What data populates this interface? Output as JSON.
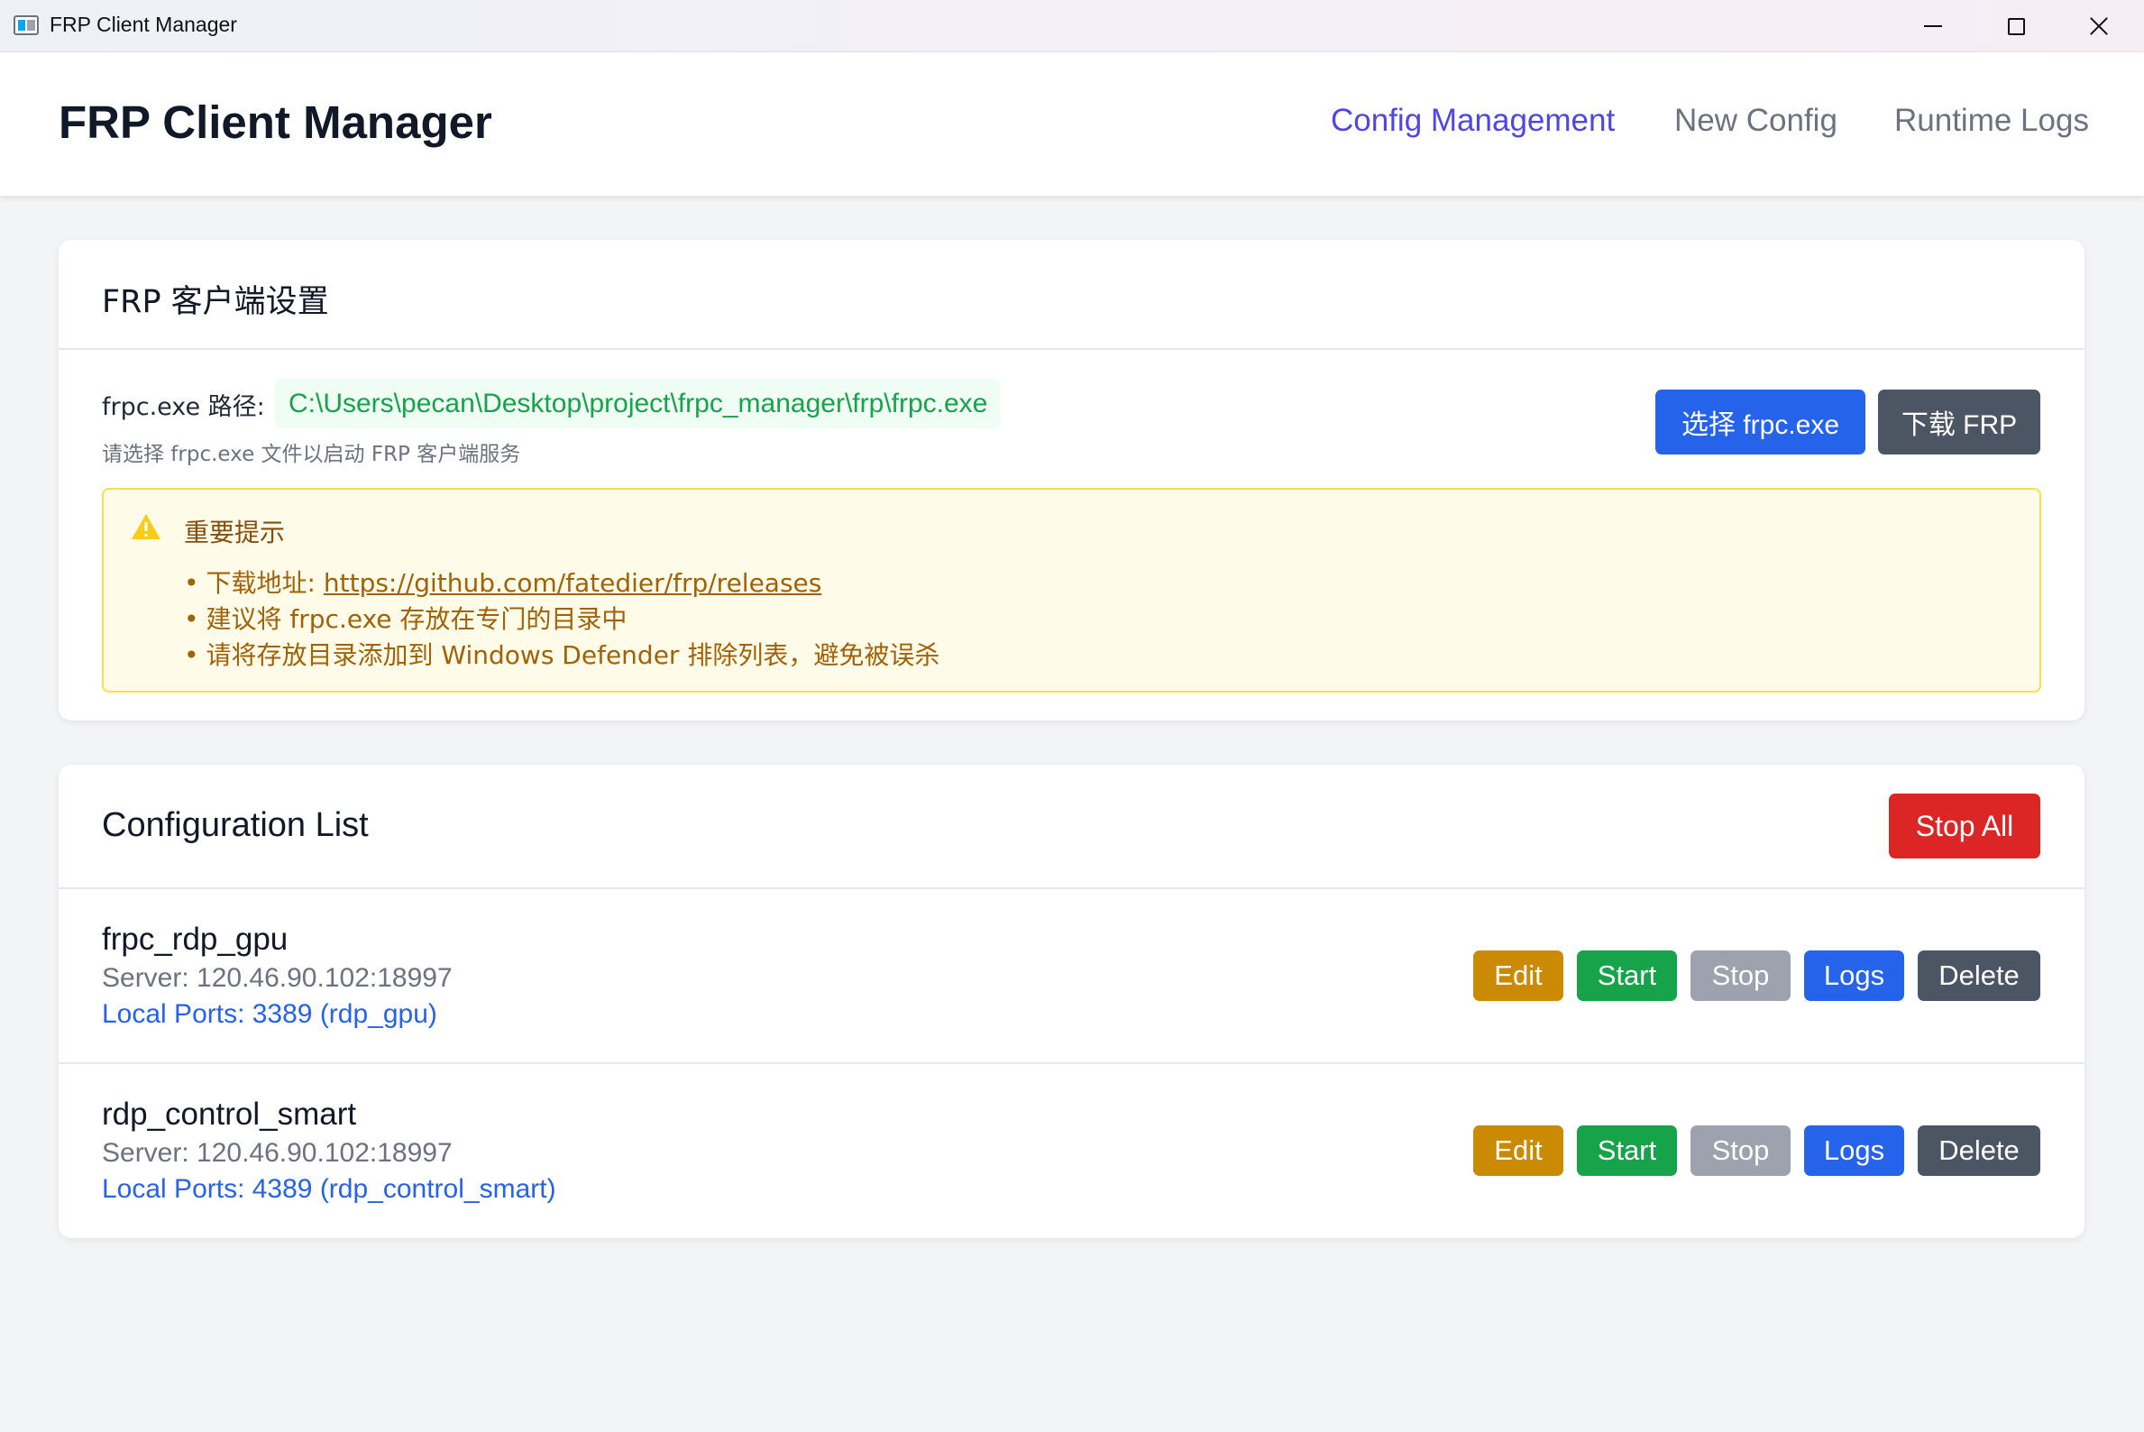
{
  "window": {
    "title": "FRP Client Manager"
  },
  "header": {
    "title": "FRP Client Manager",
    "nav": [
      {
        "label": "Config Management",
        "active": true
      },
      {
        "label": "New Config",
        "active": false
      },
      {
        "label": "Runtime Logs",
        "active": false
      }
    ]
  },
  "settings": {
    "title": "FRP 客户端设置",
    "path_label": "frpc.exe 路径:",
    "path_value": "C:\\Users\\pecan\\Desktop\\project\\frpc_manager\\frp\\frpc.exe",
    "hint": "请选择 frpc.exe 文件以启动 FRP 客户端服务",
    "select_button": "选择 frpc.exe",
    "download_button": "下载 FRP",
    "notice": {
      "icon": "warning-icon",
      "title": "重要提示",
      "download_prefix": "下载地址: ",
      "download_url": "https://github.com/fatedier/frp/releases",
      "item2": "建议将 frpc.exe 存放在专门的目录中",
      "item3": "请将存放目录添加到 Windows Defender 排除列表，避免被误杀",
      "bullet": "•"
    }
  },
  "config_list": {
    "title": "Configuration List",
    "stop_all_button": "Stop All",
    "items": [
      {
        "name": "frpc_rdp_gpu",
        "server": "Server: 120.46.90.102:18997",
        "ports": "Local Ports: 3389 (rdp_gpu)",
        "buttons": {
          "edit": "Edit",
          "start": "Start",
          "stop": "Stop",
          "logs": "Logs",
          "delete": "Delete"
        }
      },
      {
        "name": "rdp_control_smart",
        "server": "Server: 120.46.90.102:18997",
        "ports": "Local Ports: 4389 (rdp_control_smart)",
        "buttons": {
          "edit": "Edit",
          "start": "Start",
          "stop": "Stop",
          "logs": "Logs",
          "delete": "Delete"
        }
      }
    ]
  },
  "colors": {
    "accent": "#4f46e5",
    "primary": "#2563eb",
    "danger": "#dc2626",
    "success": "#16a34a",
    "warning": "#ca8a04",
    "muted": "#9ca3af",
    "dark": "#4b5563"
  }
}
